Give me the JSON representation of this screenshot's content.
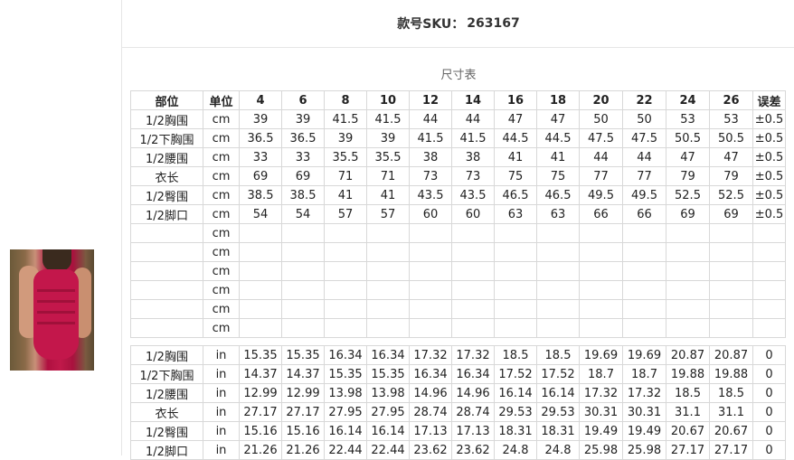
{
  "sku": {
    "label": "款号SKU：",
    "value": "263167"
  },
  "caption": "尺寸表",
  "table": {
    "headers": [
      "部位",
      "单位",
      "4",
      "6",
      "8",
      "10",
      "12",
      "14",
      "16",
      "18",
      "20",
      "22",
      "24",
      "26",
      "误差"
    ],
    "cm_rows": [
      [
        "1/2胸围",
        "cm",
        "39",
        "39",
        "41.5",
        "41.5",
        "44",
        "44",
        "47",
        "47",
        "50",
        "50",
        "53",
        "53",
        "±0.5"
      ],
      [
        "1/2下胸围",
        "cm",
        "36.5",
        "36.5",
        "39",
        "39",
        "41.5",
        "41.5",
        "44.5",
        "44.5",
        "47.5",
        "47.5",
        "50.5",
        "50.5",
        "±0.5"
      ],
      [
        "1/2腰围",
        "cm",
        "33",
        "33",
        "35.5",
        "35.5",
        "38",
        "38",
        "41",
        "41",
        "44",
        "44",
        "47",
        "47",
        "±0.5"
      ],
      [
        "衣长",
        "cm",
        "69",
        "69",
        "71",
        "71",
        "73",
        "73",
        "75",
        "75",
        "77",
        "77",
        "79",
        "79",
        "±0.5"
      ],
      [
        "1/2臀围",
        "cm",
        "38.5",
        "38.5",
        "41",
        "41",
        "43.5",
        "43.5",
        "46.5",
        "46.5",
        "49.5",
        "49.5",
        "52.5",
        "52.5",
        "±0.5"
      ],
      [
        "1/2脚口",
        "cm",
        "54",
        "54",
        "57",
        "57",
        "60",
        "60",
        "63",
        "63",
        "66",
        "66",
        "69",
        "69",
        "±0.5"
      ],
      [
        "",
        "cm",
        "",
        "",
        "",
        "",
        "",
        "",
        "",
        "",
        "",
        "",
        "",
        "",
        ""
      ],
      [
        "",
        "cm",
        "",
        "",
        "",
        "",
        "",
        "",
        "",
        "",
        "",
        "",
        "",
        "",
        ""
      ],
      [
        "",
        "cm",
        "",
        "",
        "",
        "",
        "",
        "",
        "",
        "",
        "",
        "",
        "",
        "",
        ""
      ],
      [
        "",
        "cm",
        "",
        "",
        "",
        "",
        "",
        "",
        "",
        "",
        "",
        "",
        "",
        "",
        ""
      ],
      [
        "",
        "cm",
        "",
        "",
        "",
        "",
        "",
        "",
        "",
        "",
        "",
        "",
        "",
        "",
        ""
      ],
      [
        "",
        "cm",
        "",
        "",
        "",
        "",
        "",
        "",
        "",
        "",
        "",
        "",
        "",
        "",
        ""
      ]
    ],
    "in_rows": [
      [
        "1/2胸围",
        "in",
        "15.35",
        "15.35",
        "16.34",
        "16.34",
        "17.32",
        "17.32",
        "18.5",
        "18.5",
        "19.69",
        "19.69",
        "20.87",
        "20.87",
        "0"
      ],
      [
        "1/2下胸围",
        "in",
        "14.37",
        "14.37",
        "15.35",
        "15.35",
        "16.34",
        "16.34",
        "17.52",
        "17.52",
        "18.7",
        "18.7",
        "19.88",
        "19.88",
        "0"
      ],
      [
        "1/2腰围",
        "in",
        "12.99",
        "12.99",
        "13.98",
        "13.98",
        "14.96",
        "14.96",
        "16.14",
        "16.14",
        "17.32",
        "17.32",
        "18.5",
        "18.5",
        "0"
      ],
      [
        "衣长",
        "in",
        "27.17",
        "27.17",
        "27.95",
        "27.95",
        "28.74",
        "28.74",
        "29.53",
        "29.53",
        "30.31",
        "30.31",
        "31.1",
        "31.1",
        "0"
      ],
      [
        "1/2臀围",
        "in",
        "15.16",
        "15.16",
        "16.14",
        "16.14",
        "17.13",
        "17.13",
        "18.31",
        "18.31",
        "19.49",
        "19.49",
        "20.67",
        "20.67",
        "0"
      ],
      [
        "1/2脚口",
        "in",
        "21.26",
        "21.26",
        "22.44",
        "22.44",
        "23.62",
        "23.62",
        "24.8",
        "24.8",
        "25.98",
        "25.98",
        "27.17",
        "27.17",
        "0"
      ]
    ]
  }
}
